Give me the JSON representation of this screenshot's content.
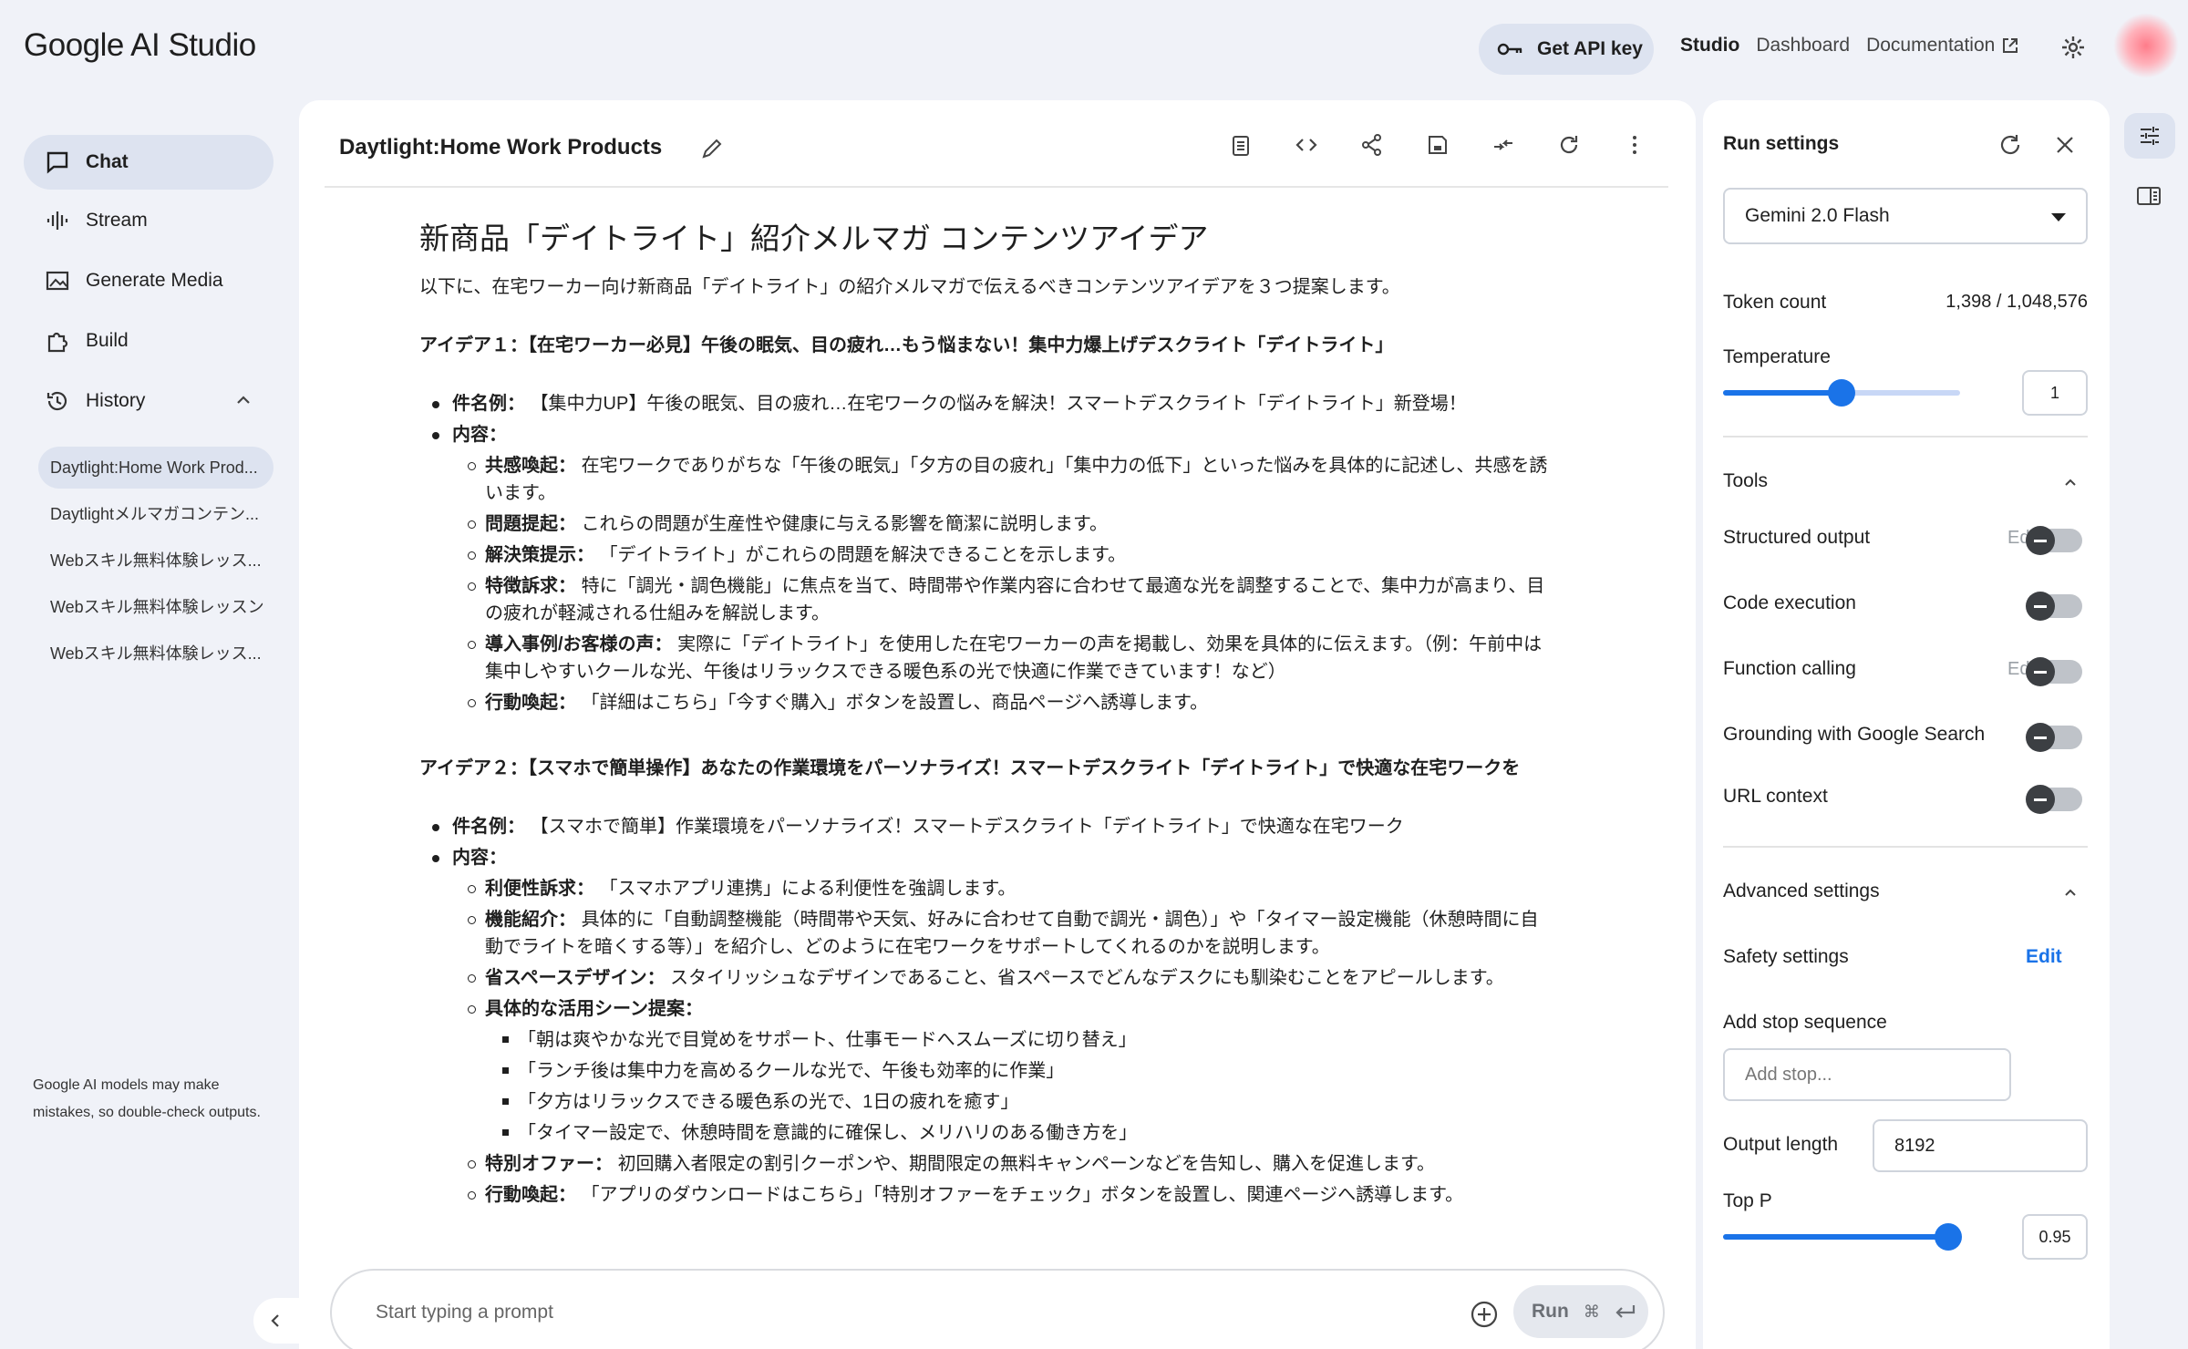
{
  "header": {
    "logo": "Google AI Studio",
    "api_key_label": "Get API key",
    "nav": [
      "Studio",
      "Dashboard",
      "Documentation"
    ]
  },
  "sidebar": {
    "items": [
      {
        "label": "Chat",
        "icon": "chat-icon"
      },
      {
        "label": "Stream",
        "icon": "waveform-icon"
      },
      {
        "label": "Generate Media",
        "icon": "image-icon"
      },
      {
        "label": "Build",
        "icon": "puzzle-icon"
      },
      {
        "label": "History",
        "icon": "history-icon"
      }
    ],
    "history": [
      "Daytlight:Home Work Prod...",
      "Daytlightメルマガコンテン...",
      "Webスキル無料体験レッス...",
      "Webスキル無料体験レッスン",
      "Webスキル無料体験レッス..."
    ],
    "disclaimer": "Google AI models may make mistakes, so double-check outputs."
  },
  "chat": {
    "title": "Daytlight:Home Work Products",
    "heading": "新商品「デイトライト」紹介メルマガ コンテンツアイデア",
    "intro": "以下に、在宅ワーカー向け新商品「デイトライト」の紹介メルマガで伝えるべきコンテンツアイデアを３つ提案します。",
    "idea1": {
      "title": "アイデア１：【在宅ワーカー必見】午後の眠気、目の疲れ…もう悩まない！集中力爆上げデスクライト「デイトライト」",
      "subject_label": "件名例：",
      "subject": "【集中力UP】午後の眠気、目の疲れ…在宅ワークの悩みを解決！スマートデスクライト「デイトライト」新登場！",
      "content_label": "内容：",
      "points": [
        {
          "label": "共感喚起：",
          "text": "在宅ワークでありがちな「午後の眠気」「夕方の目の疲れ」「集中力の低下」といった悩みを具体的に記述し、共感を誘います。"
        },
        {
          "label": "問題提起：",
          "text": "これらの問題が生産性や健康に与える影響を簡潔に説明します。"
        },
        {
          "label": "解決策提示：",
          "text": "「デイトライト」がこれらの問題を解決できることを示します。"
        },
        {
          "label": "特徴訴求：",
          "text": "特に「調光・調色機能」に焦点を当て、時間帯や作業内容に合わせて最適な光を調整することで、集中力が高まり、目の疲れが軽減される仕組みを解説します。"
        },
        {
          "label": "導入事例/お客様の声：",
          "text": "実際に「デイトライト」を使用した在宅ワーカーの声を掲載し、効果を具体的に伝えます。（例：午前中は集中しやすいクールな光、午後はリラックスできる暖色系の光で快適に作業できています！など）"
        },
        {
          "label": "行動喚起：",
          "text": "「詳細はこちら」「今すぐ購入」ボタンを設置し、商品ページへ誘導します。"
        }
      ]
    },
    "idea2": {
      "title": "アイデア２：【スマホで簡単操作】あなたの作業環境をパーソナライズ！スマートデスクライト「デイトライト」で快適な在宅ワークを",
      "subject_label": "件名例：",
      "subject": "【スマホで簡単】作業環境をパーソナライズ！スマートデスクライト「デイトライト」で快適な在宅ワーク",
      "content_label": "内容：",
      "points": [
        {
          "label": "利便性訴求：",
          "text": "「スマホアプリ連携」による利便性を強調します。"
        },
        {
          "label": "機能紹介：",
          "text": "具体的に「自動調整機能（時間帯や天気、好みに合わせて自動で調光・調色）」や「タイマー設定機能（休憩時間に自動でライトを暗くする等）」を紹介し、どのように在宅ワークをサポートしてくれるのかを説明します。"
        },
        {
          "label": "省スペースデザイン：",
          "text": "スタイリッシュなデザインであること、省スペースでどんなデスクにも馴染むことをアピールします。"
        },
        {
          "label": "具体的な活用シーン提案：",
          "text": ""
        }
      ],
      "scenes": [
        "「朝は爽やかな光で目覚めをサポート、仕事モードへスムーズに切り替え」",
        "「ランチ後は集中力を高めるクールな光で、午後も効率的に作業」",
        "「夕方はリラックスできる暖色系の光で、1日の疲れを癒す」",
        "「タイマー設定で、休憩時間を意識的に確保し、メリハリのある働き方を」"
      ],
      "points_after": [
        {
          "label": "特別オファー：",
          "text": "初回購入者限定の割引クーポンや、期間限定の無料キャンペーンなどを告知し、購入を促進します。"
        },
        {
          "label": "行動喚起：",
          "text": "「アプリのダウンロードはこちら」「特別オファーをチェック」ボタンを設置し、関連ページへ誘導します。"
        }
      ]
    },
    "prompt_placeholder": "Start typing a prompt",
    "run_label": "Run",
    "run_shortcut": "⌘"
  },
  "settings": {
    "title": "Run settings",
    "model": "Gemini 2.0 Flash",
    "token_count_label": "Token count",
    "token_count": "1,398 / 1,048,576",
    "temperature_label": "Temperature",
    "temperature_value": "1",
    "temperature_fraction": 0.5,
    "tools_label": "Tools",
    "tools": [
      {
        "label": "Structured output",
        "edit": "Edit",
        "on": false
      },
      {
        "label": "Code execution",
        "edit": "",
        "on": false
      },
      {
        "label": "Function calling",
        "edit": "Edit",
        "on": false
      },
      {
        "label": "Grounding with Google Search",
        "edit": "",
        "on": false
      },
      {
        "label": "URL context",
        "edit": "",
        "on": false
      }
    ],
    "advanced_label": "Advanced settings",
    "safety_label": "Safety settings",
    "safety_edit": "Edit",
    "stop_label": "Add stop sequence",
    "stop_placeholder": "Add stop...",
    "output_length_label": "Output length",
    "output_length": "8192",
    "top_p_label": "Top P",
    "top_p_value": "0.95",
    "top_p_fraction": 0.95,
    "colors": {
      "accent": "#1a73e8",
      "active_bg": "#dde3f0",
      "page_bg": "#f0f2f8"
    }
  }
}
